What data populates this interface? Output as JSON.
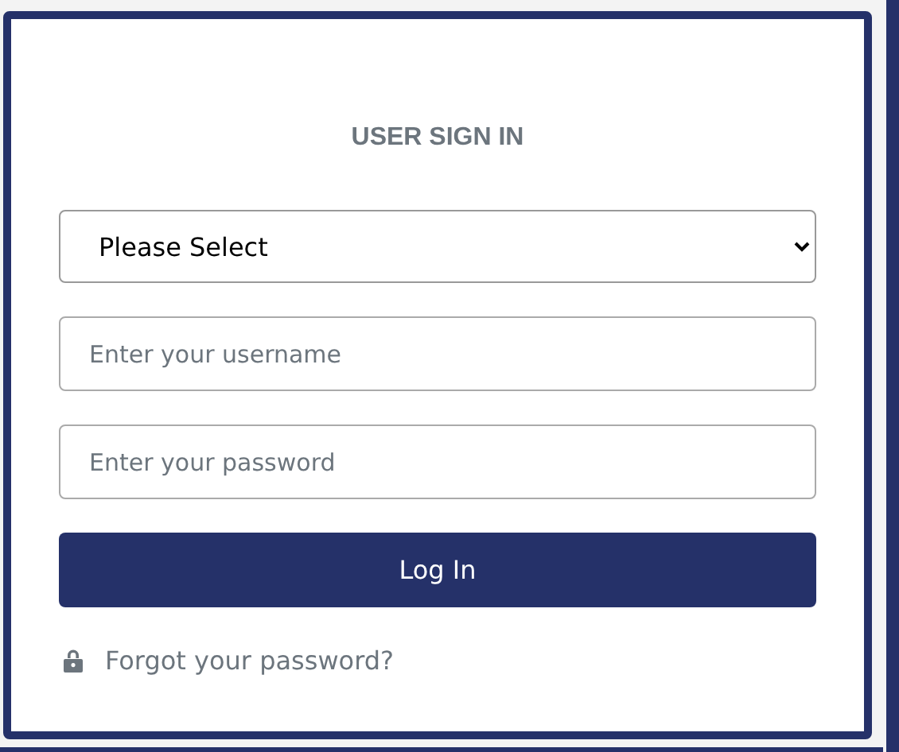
{
  "title": "USER SIGN IN",
  "select": {
    "value": "Please Select"
  },
  "fields": [
    {
      "placeholder": "Enter your username"
    },
    {
      "placeholder": "Enter your password"
    }
  ],
  "button": "Log In",
  "forgot_link": "Forgot your password?"
}
